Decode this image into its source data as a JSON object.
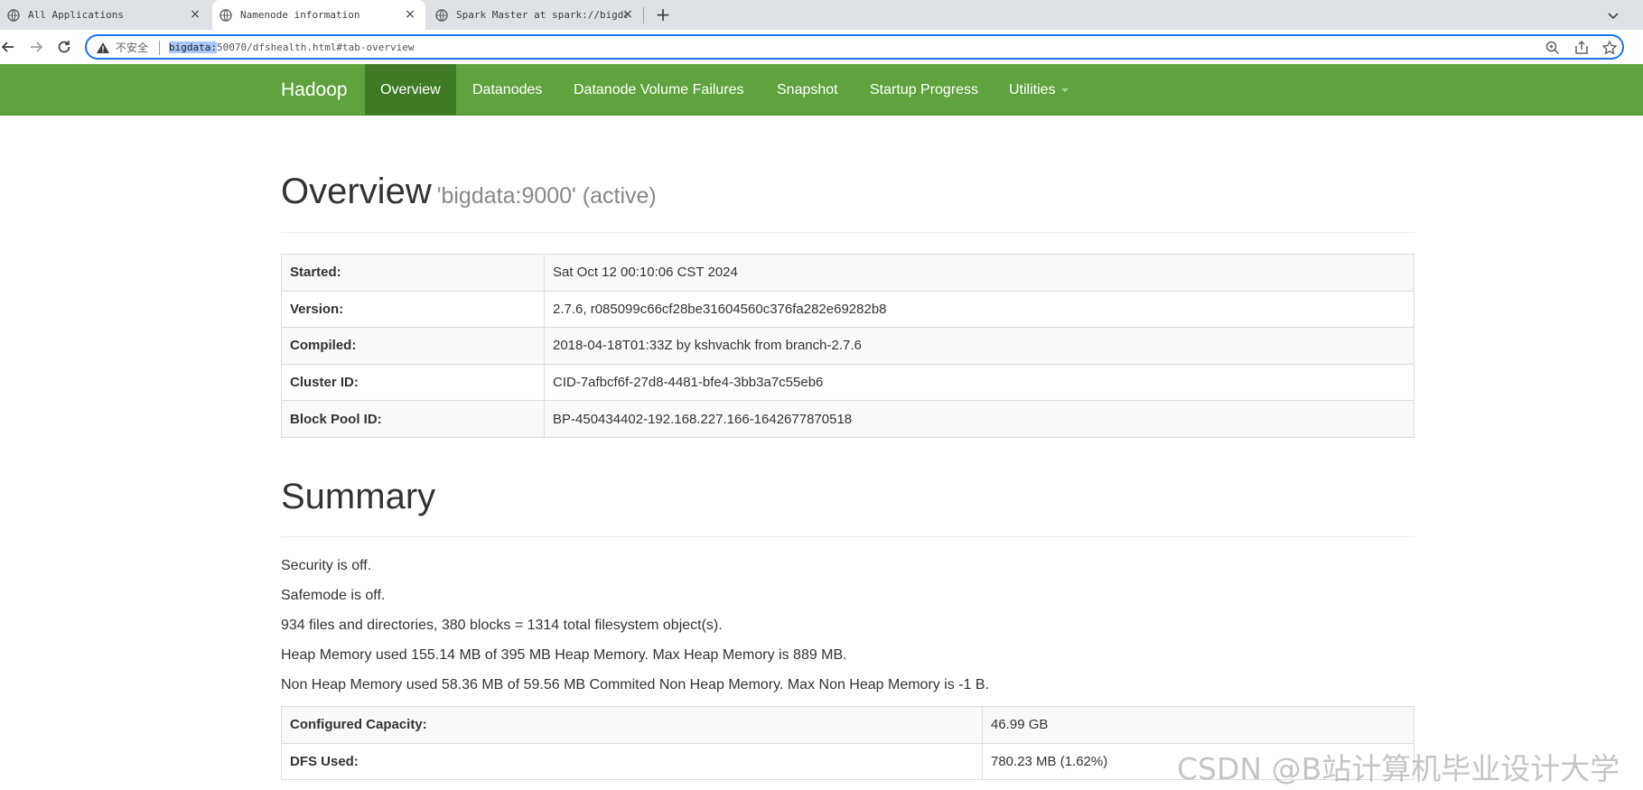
{
  "browser": {
    "tabs": [
      {
        "title": "All Applications"
      },
      {
        "title": "Namenode information"
      },
      {
        "title": "Spark Master at spark://bigda"
      }
    ],
    "address": {
      "insecure_label": "不安全",
      "host": "bigdata:",
      "rest": "50070/dfshealth.html#tab-overview"
    }
  },
  "navbar": {
    "brand": "Hadoop",
    "items": [
      "Overview",
      "Datanodes",
      "Datanode Volume Failures",
      "Snapshot",
      "Startup Progress",
      "Utilities"
    ],
    "accent": "#5fa33e",
    "active_bg": "#3f7a25"
  },
  "overview": {
    "title": "Overview",
    "subtitle": "'bigdata:9000' (active)",
    "rows": [
      {
        "label": "Started:",
        "value": "Sat Oct 12 00:10:06 CST 2024"
      },
      {
        "label": "Version:",
        "value": "2.7.6, r085099c66cf28be31604560c376fa282e69282b8"
      },
      {
        "label": "Compiled:",
        "value": "2018-04-18T01:33Z by kshvachk from branch-2.7.6"
      },
      {
        "label": "Cluster ID:",
        "value": "CID-7afbcf6f-27d8-4481-bfe4-3bb3a7c55eb6"
      },
      {
        "label": "Block Pool ID:",
        "value": "BP-450434402-192.168.227.166-1642677870518"
      }
    ]
  },
  "summary": {
    "title": "Summary",
    "lines": [
      "Security is off.",
      "Safemode is off.",
      "934 files and directories, 380 blocks = 1314 total filesystem object(s).",
      "Heap Memory used 155.14 MB of 395 MB Heap Memory. Max Heap Memory is 889 MB.",
      "Non Heap Memory used 58.36 MB of 59.56 MB Commited Non Heap Memory. Max Non Heap Memory is -1 B."
    ],
    "rows": [
      {
        "label": "Configured Capacity:",
        "value": "46.99 GB"
      },
      {
        "label": "DFS Used:",
        "value": "780.23 MB (1.62%)"
      }
    ]
  },
  "watermark": "CSDN @B站计算机毕业设计大学"
}
